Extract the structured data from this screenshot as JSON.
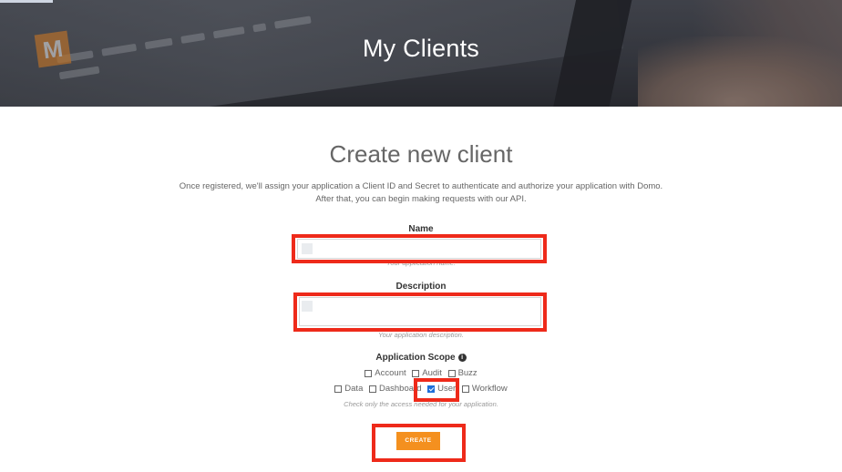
{
  "hero": {
    "title": "My Clients"
  },
  "form": {
    "heading": "Create new client",
    "intro_line1": "Once registered, we'll assign your application a Client ID and Secret to authenticate and authorize your application with Domo.",
    "intro_line2": "After that, you can begin making requests with our API.",
    "name": {
      "label": "Name",
      "value": "",
      "hint": "Your application name."
    },
    "description": {
      "label": "Description",
      "value": "",
      "hint": "Your application description."
    },
    "scope": {
      "label": "Application Scope",
      "info_icon": "info-circle-icon",
      "row1": [
        {
          "label": "Account",
          "checked": false
        },
        {
          "label": "Audit",
          "checked": false
        },
        {
          "label": "Buzz",
          "checked": false
        }
      ],
      "row2": [
        {
          "label": "Data",
          "checked": false
        },
        {
          "label": "Dashboard",
          "checked": false
        },
        {
          "label": "User",
          "checked": true
        },
        {
          "label": "Workflow",
          "checked": false
        }
      ],
      "hint": "Check only the access needed for your application."
    },
    "create_label": "CREATE"
  },
  "colors": {
    "accent": "#f4901f",
    "highlight": "#ee2a1a",
    "checkbox": "#1e6fd9"
  }
}
